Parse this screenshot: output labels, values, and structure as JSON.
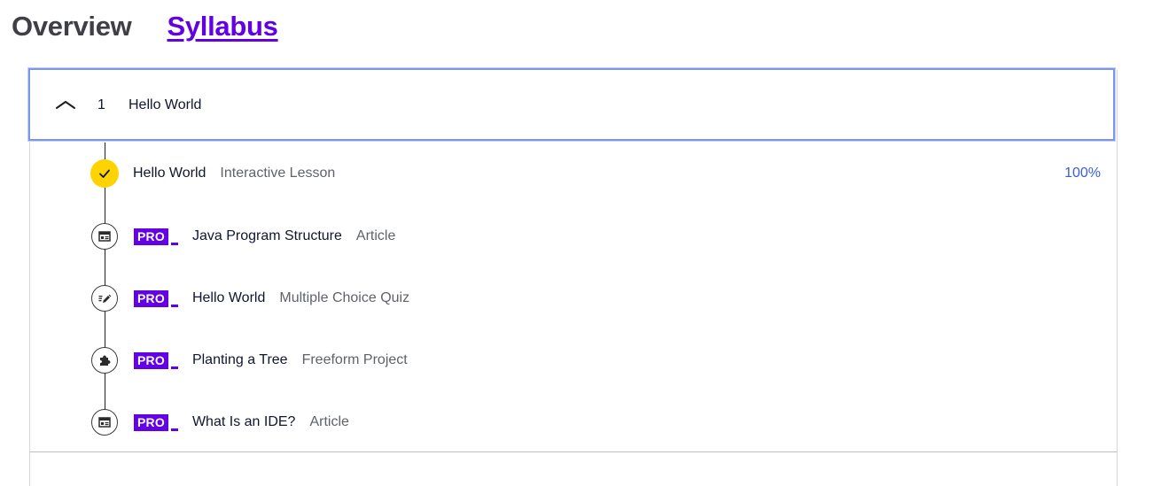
{
  "tabs": {
    "overview": "Overview",
    "syllabus": "Syllabus"
  },
  "module": {
    "number": "1",
    "title": "Hello World",
    "expanded": true
  },
  "lessons": [
    {
      "title": "Hello World",
      "type": "Interactive Lesson",
      "icon": "check-icon",
      "pro": false,
      "progress": "100%",
      "complete": true
    },
    {
      "title": "Java Program Structure",
      "type": "Article",
      "icon": "article-icon",
      "pro": true,
      "pro_label": "PRO"
    },
    {
      "title": "Hello World",
      "type": "Multiple Choice Quiz",
      "icon": "quiz-pencil-icon",
      "pro": true,
      "pro_label": "PRO"
    },
    {
      "title": "Planting a Tree",
      "type": "Freeform Project",
      "icon": "puzzle-icon",
      "pro": true,
      "pro_label": "PRO"
    },
    {
      "title": "What Is an IDE?",
      "type": "Article",
      "icon": "article-icon",
      "pro": true,
      "pro_label": "PRO"
    }
  ],
  "colors": {
    "accent": "#6400e4",
    "complete": "#ffd300",
    "progress": "#3a5ce0",
    "focus_ring": "#7a96ef"
  }
}
